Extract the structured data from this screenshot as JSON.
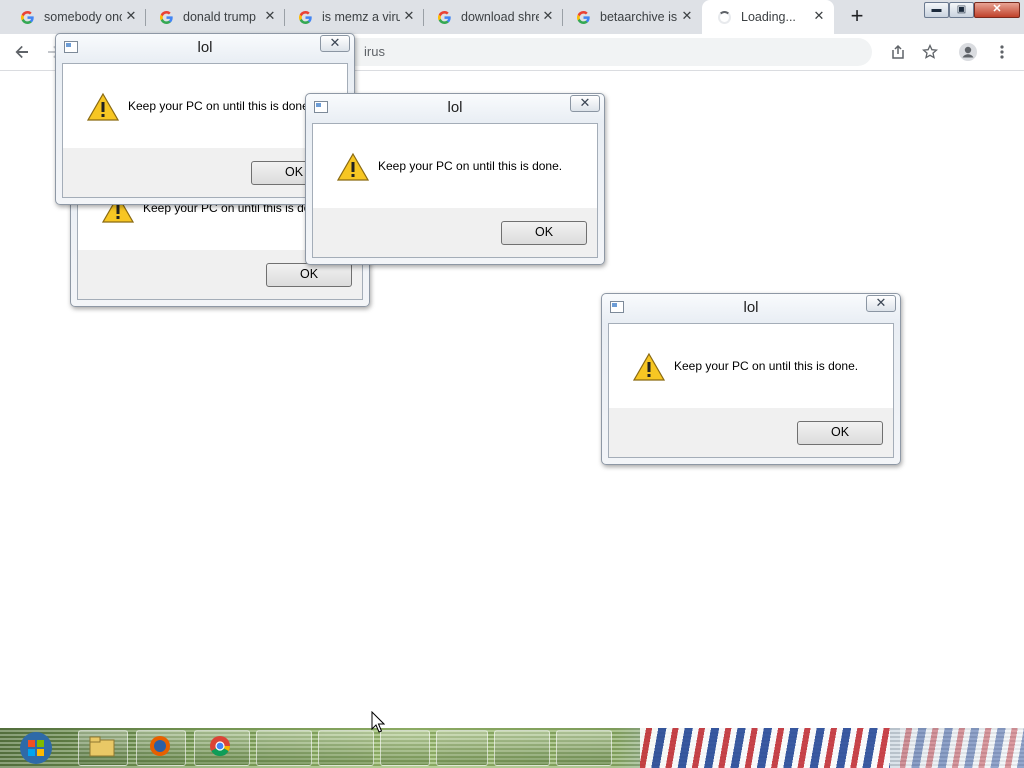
{
  "browser": {
    "tabs": [
      {
        "title": "somebody once told me",
        "icon": "google-icon"
      },
      {
        "title": "donald trump",
        "icon": "google-icon"
      },
      {
        "title": "is memz a virus",
        "icon": "google-icon"
      },
      {
        "title": "download shrek",
        "icon": "google-icon"
      },
      {
        "title": "betaarchive is",
        "icon": "google-icon"
      },
      {
        "title": "Loading...",
        "icon": "loading-spinner-icon",
        "active": true
      }
    ],
    "new_tab_label": "+",
    "window_controls": {
      "minimize": "▬",
      "maximize": "▣",
      "close": "✕"
    },
    "url_visible_text": "irus"
  },
  "dialogs": [
    {
      "title": "lol",
      "message": "Keep your PC on until this is done.",
      "ok_label": "OK"
    },
    {
      "title": "lol",
      "message": "Keep your PC on until this is done.",
      "ok_label": "OK"
    },
    {
      "title": "lol",
      "message": "Keep your PC on until this is done.",
      "ok_label": "OK"
    },
    {
      "title": "lol",
      "message": "Keep your PC on until this is done.",
      "ok_label": "OK"
    }
  ],
  "dialog_close_label": "✕",
  "colors": {
    "tabstrip": "#dee1e6",
    "taskbar_green": "#7fa35a",
    "google_blue": "#4285f4"
  }
}
